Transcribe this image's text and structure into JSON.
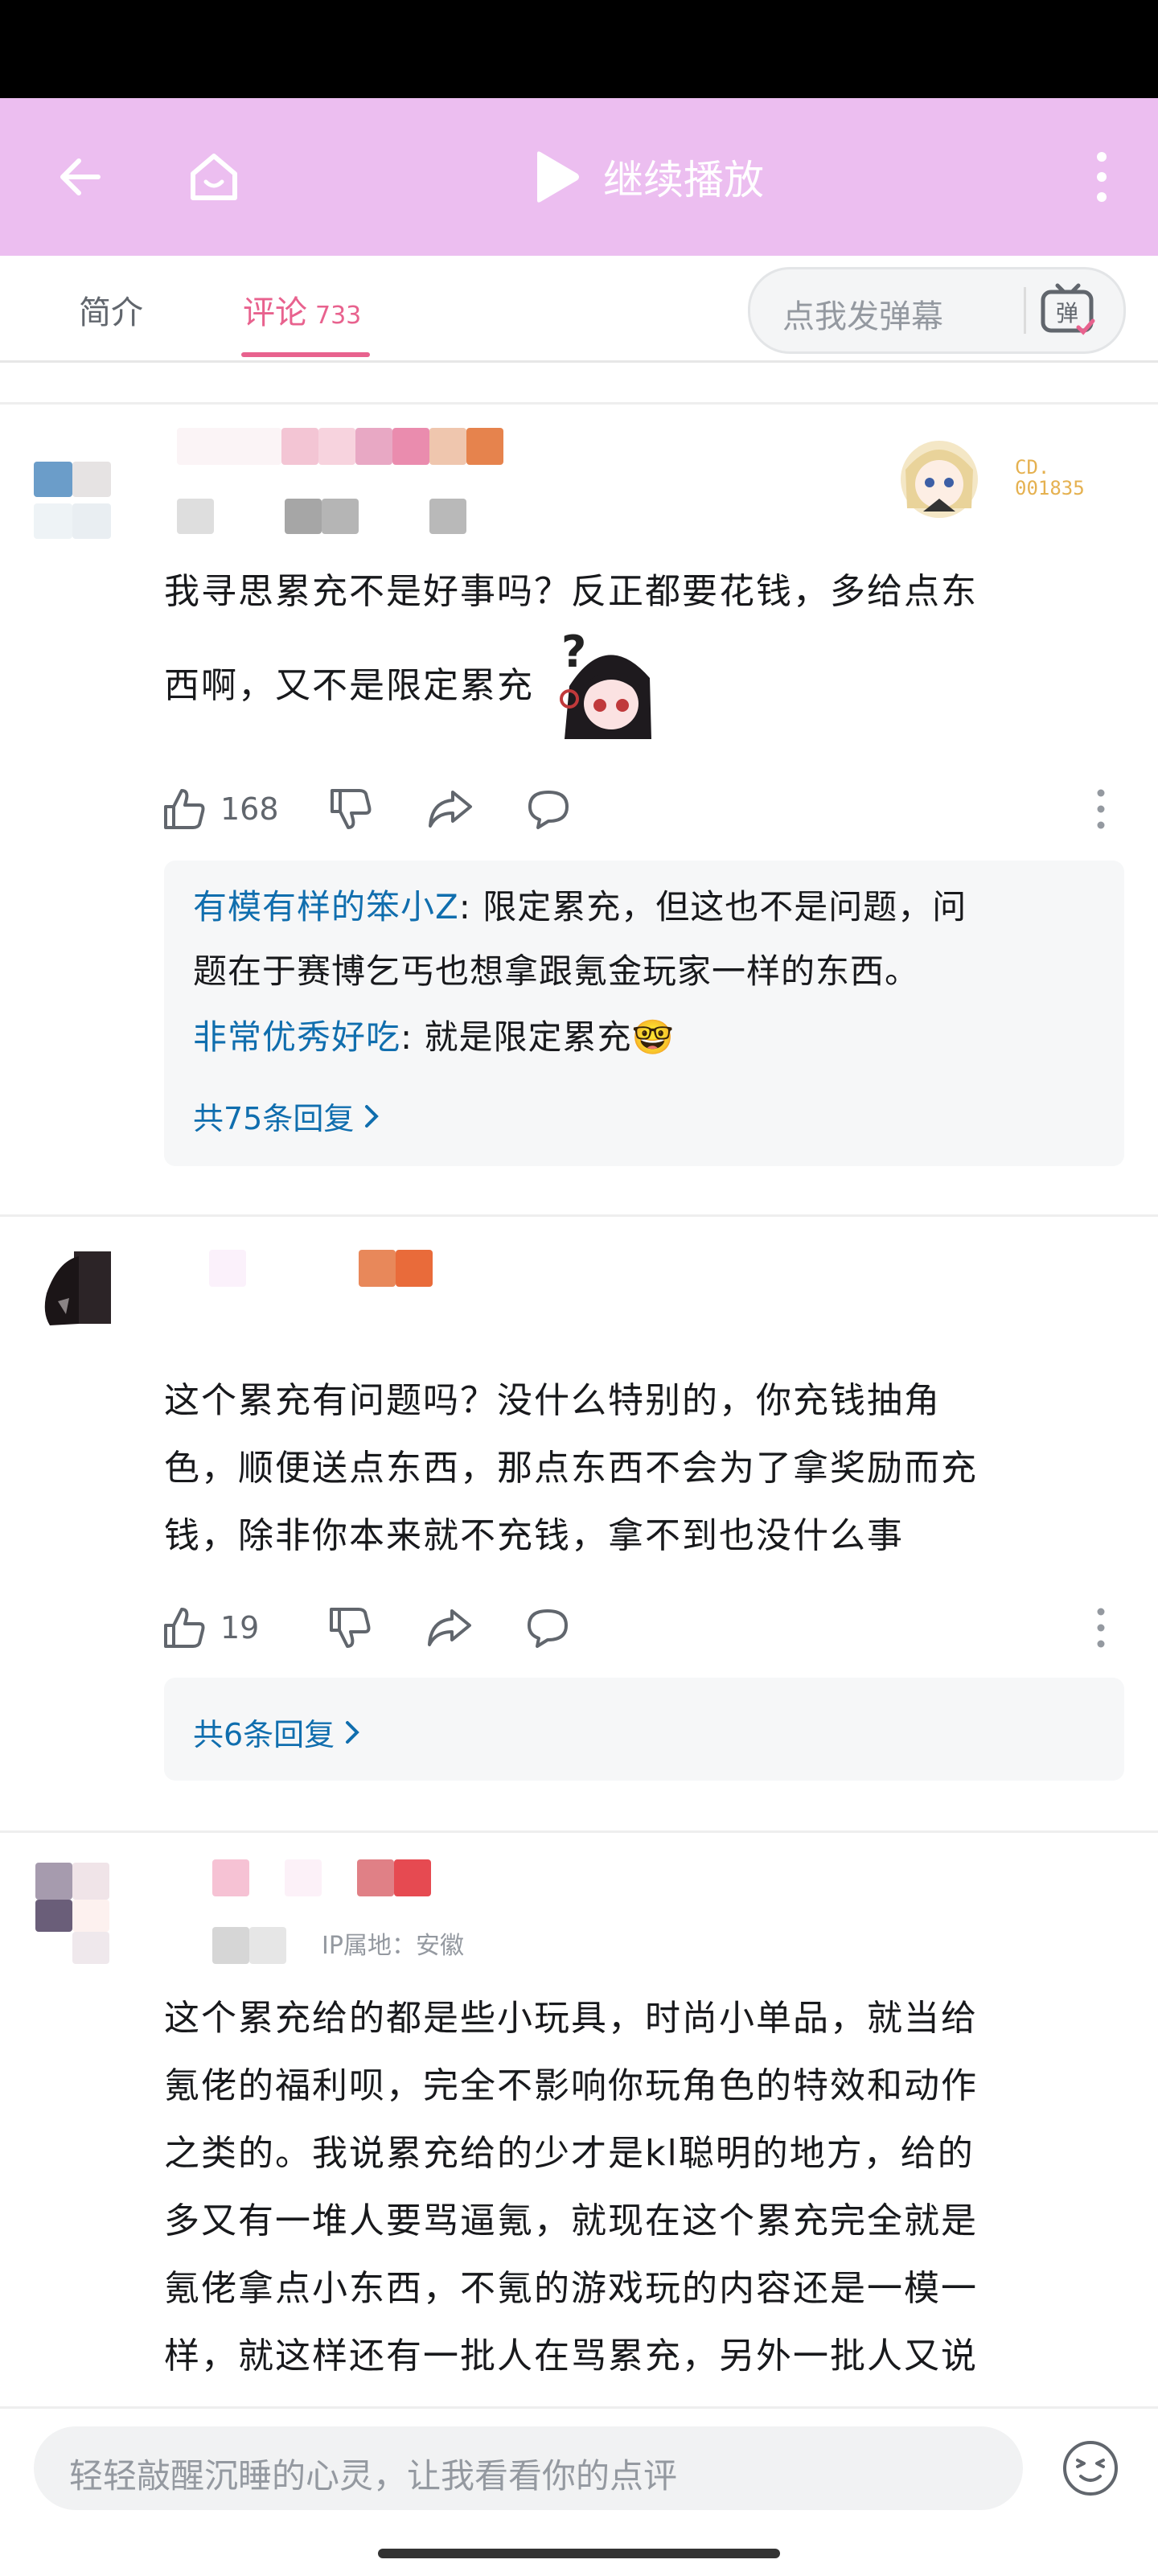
{
  "topbar": {
    "play_label": "继续播放"
  },
  "tabs": {
    "intro": "简介",
    "comments": "评论",
    "comments_count": "733"
  },
  "danmu": {
    "placeholder": "点我发弹幕",
    "icon_char": "弹"
  },
  "comments": [
    {
      "text_lines": [
        "我寻思累充不是好事吗？反正都要花钱，多给点东",
        "西啊，又不是限定累充"
      ],
      "likes": "168",
      "badge_text": "CD.\n001835",
      "replies": [
        {
          "name": "有模有样的笨小Z",
          "text_line1": ": 限定累充，但这也不是问题，问",
          "text_line2": "题在于赛博乞丐也想拿跟氪金玩家一样的东西。"
        },
        {
          "name": "非常优秀好吃",
          "text_line1": ": 就是限定累充🤓"
        }
      ],
      "reply_count_label": "共75条回复"
    },
    {
      "text_lines": [
        "这个累充有问题吗？没什么特别的，你充钱抽角",
        "色，顺便送点东西，那点东西不会为了拿奖励而充",
        "钱，除非你本来就不充钱，拿不到也没什么事"
      ],
      "likes": "19",
      "reply_count_label": "共6条回复"
    },
    {
      "location": "IP属地：安徽",
      "text_lines": [
        "这个累充给的都是些小玩具，时尚小单品，就当给",
        "氪佬的福利呗，完全不影响你玩角色的特效和动作",
        "之类的。我说累充给的少才是kl聪明的地方，给的",
        "多又有一堆人要骂逼氪，就现在这个累充完全就是",
        "氪佬拿点小东西，不氪的游戏玩的内容还是一模一",
        "样，就这样还有一批人在骂累充，另外一批人又说"
      ]
    }
  ],
  "bottom": {
    "input_placeholder": "轻轻敲醒沉睡的心灵，让我看看你的点评"
  }
}
